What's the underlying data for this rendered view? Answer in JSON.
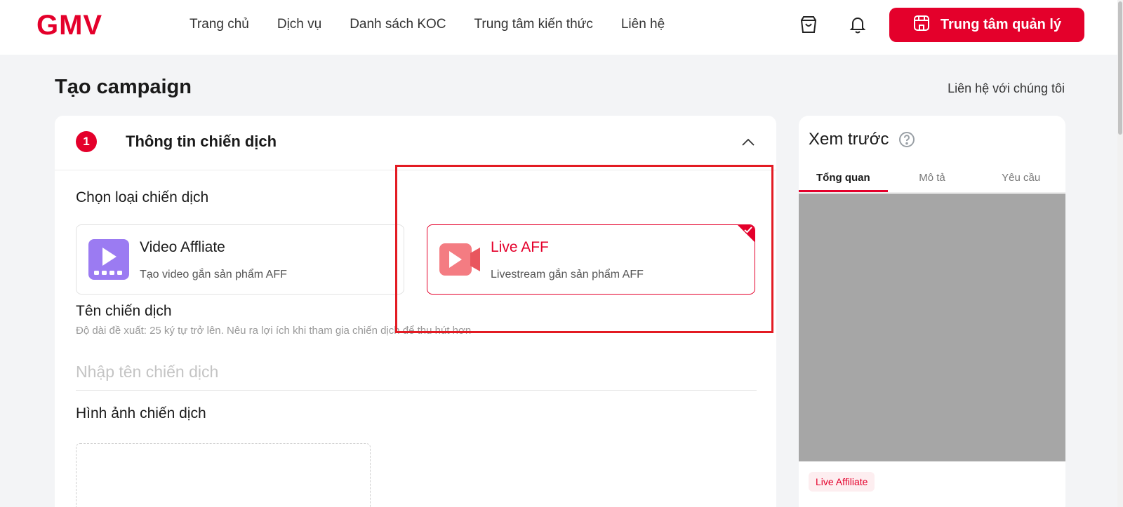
{
  "header": {
    "logo": "GMV",
    "nav": [
      "Trang chủ",
      "Dịch vụ",
      "Danh sách KOC",
      "Trung tâm kiến thức",
      "Liên hệ"
    ],
    "manage_button": "Trung tâm quản lý"
  },
  "page": {
    "title": "Tạo campaign",
    "contact": "Liên hệ với chúng tôi"
  },
  "form": {
    "step_number": "1",
    "step_title": "Thông tin chiến dịch",
    "type_label": "Chọn loại chiến dịch",
    "types": [
      {
        "title": "Video Affliate",
        "desc": "Tạo video gắn sản phẩm AFF",
        "selected": false
      },
      {
        "title": "Live AFF",
        "desc": "Livestream gắn sản phẩm AFF",
        "selected": true
      }
    ],
    "name_label": "Tên chiến dịch",
    "name_hint": "Độ dài đề xuất: 25 ký tự trở lên. Nêu ra lợi ích khi tham gia chiến dịch để thu hút hơn",
    "name_placeholder": "Nhập tên chiến dịch",
    "image_label": "Hình ảnh chiến dịch"
  },
  "preview": {
    "title": "Xem trước",
    "tabs": [
      "Tổng quan",
      "Mô tả",
      "Yêu cầu"
    ],
    "active_tab": 0,
    "tag": "Live Affiliate"
  },
  "colors": {
    "brand": "#e4002b",
    "highlight": "#e31b23",
    "video_icon": "#9b7bf2",
    "live_icon": "#f47c82"
  },
  "icons": {
    "cart": "shopping-bag-icon",
    "bell": "bell-icon",
    "store": "store-icon",
    "collapse": "chevron-up-icon",
    "help": "question-circle-icon",
    "video": "video-play-icon",
    "live": "camera-play-icon"
  }
}
